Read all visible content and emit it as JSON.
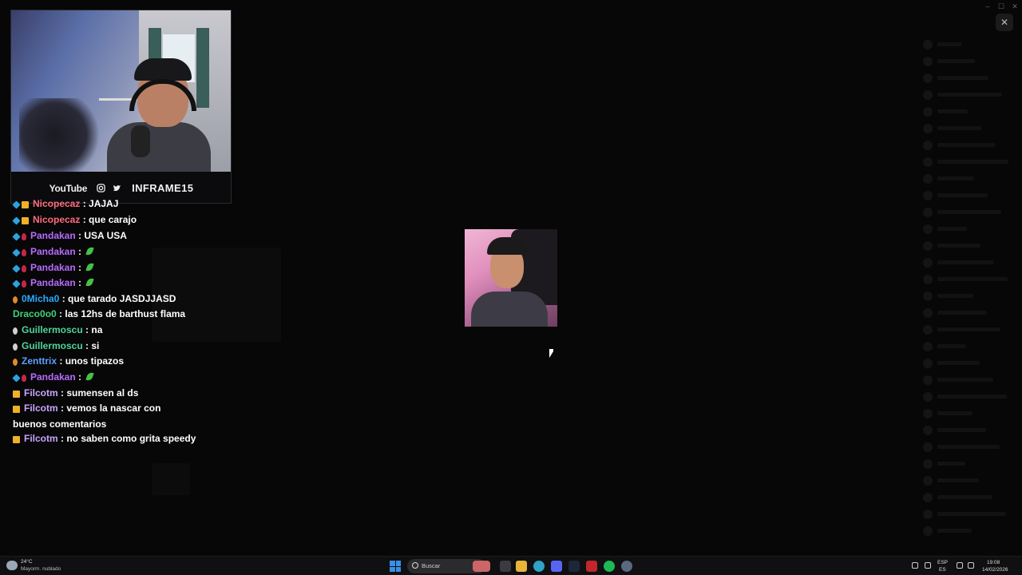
{
  "overlay": {
    "close_label": "✕"
  },
  "webcam": {
    "platform_label": "YouTube",
    "socials": [
      "instagram-icon",
      "twitter-icon"
    ],
    "handle": "INFRAME15"
  },
  "chat": {
    "messages": [
      {
        "badges": [
          "cube",
          "crown"
        ],
        "user": "Nicopecaz",
        "color": "#ff6b7f",
        "text": "JAJAJ"
      },
      {
        "badges": [
          "cube",
          "crown"
        ],
        "user": "Nicopecaz",
        "color": "#ff6b7f",
        "text": "que carajo"
      },
      {
        "badges": [
          "cube",
          "gem"
        ],
        "user": "Pandakan",
        "color": "#b86bff",
        "text": "USA USA"
      },
      {
        "badges": [
          "cube",
          "gem"
        ],
        "user": "Pandakan",
        "color": "#b86bff",
        "text": "",
        "emote": "leaf-emote"
      },
      {
        "badges": [
          "cube",
          "gem"
        ],
        "user": "Pandakan",
        "color": "#b86bff",
        "text": "",
        "emote": "leaf-emote"
      },
      {
        "badges": [
          "cube",
          "gem"
        ],
        "user": "Pandakan",
        "color": "#b86bff",
        "text": "",
        "emote": "leaf-emote"
      },
      {
        "badges": [
          "orange"
        ],
        "user": "0Micha0",
        "color": "#2aa8ff",
        "text": "que tarado JASDJJASD"
      },
      {
        "badges": [],
        "user": "Draco0o0",
        "color": "#3fd17a",
        "text": "las 12hs de barthust flama"
      },
      {
        "badges": [
          "white"
        ],
        "user": "Guillermoscu",
        "color": "#4fd39a",
        "text": "na"
      },
      {
        "badges": [
          "white"
        ],
        "user": "Guillermoscu",
        "color": "#4fd39a",
        "text": "si"
      },
      {
        "badges": [
          "orange"
        ],
        "user": "Zenttrix",
        "color": "#5aa0ff",
        "text": "unos tipazos"
      },
      {
        "badges": [
          "cube",
          "gem"
        ],
        "user": "Pandakan",
        "color": "#b86bff",
        "text": "",
        "emote": "leaf-emote"
      },
      {
        "badges": [
          "crown"
        ],
        "user": "Filcotm",
        "color": "#c9a4ff",
        "text": "sumensen al ds"
      },
      {
        "badges": [
          "crown"
        ],
        "user": "Filcotm",
        "color": "#c9a4ff",
        "text": "vemos la nascar con buenos comentarios"
      },
      {
        "badges": [
          "crown"
        ],
        "user": "Filcotm",
        "color": "#c9a4ff",
        "text": "no saben como grita speedy"
      }
    ]
  },
  "taskbar": {
    "weather_temp": "24°C",
    "weather_cond": "Mayorm. nublado",
    "search_placeholder": "Buscar",
    "lang_top": "ESP",
    "lang_bottom": "ES",
    "time": "19:08",
    "date": "14/02/2026",
    "apps": [
      "task-view-icon",
      "file-explorer-icon",
      "edge-icon",
      "discord-icon",
      "steam-icon",
      "game-launcher-icon",
      "spotify-icon",
      "settings-icon"
    ]
  }
}
